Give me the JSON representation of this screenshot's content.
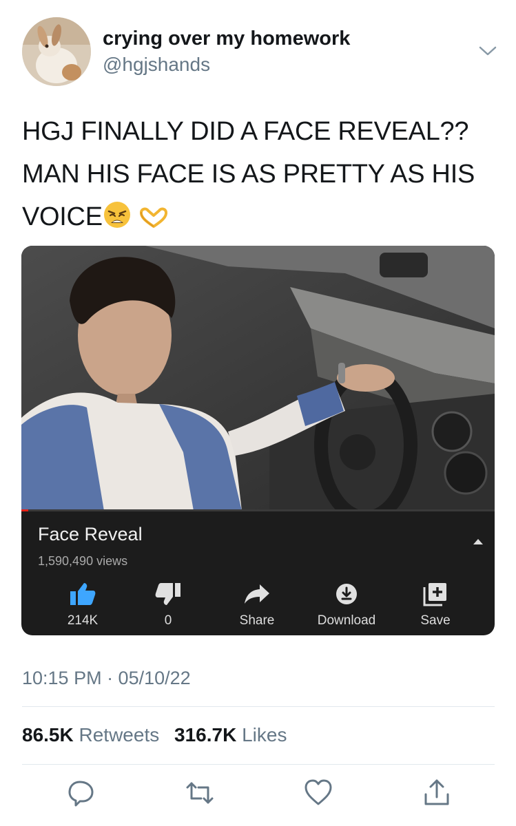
{
  "author": {
    "display_name": "crying over my homework",
    "handle": "@hgjshands"
  },
  "tweet": {
    "text_lines": [
      "HGJ FINALLY DID A FACE REVEAL??",
      "MAN HIS FACE IS AS PRETTY AS HIS",
      "VOICE"
    ],
    "emojis": [
      "weary-face-emoji",
      "heart-hands-emoji"
    ]
  },
  "video_card": {
    "title": "Face Reveal",
    "views": "1,590,490 views",
    "progress": 0.015,
    "actions": [
      {
        "icon": "thumbs-up-icon",
        "label": "214K"
      },
      {
        "icon": "thumbs-down-icon",
        "label": "0"
      },
      {
        "icon": "share-icon",
        "label": "Share"
      },
      {
        "icon": "download-icon",
        "label": "Download"
      },
      {
        "icon": "save-playlist-icon",
        "label": "Save"
      }
    ],
    "colors": {
      "like_accent": "#3ea6ff",
      "progress": "#e62117",
      "background": "#1c1c1c"
    }
  },
  "timestamp": "10:15 PM · 05/10/22",
  "stats": {
    "retweets_count": "86.5K",
    "retweets_label": "Retweets",
    "likes_count": "316.7K",
    "likes_label": "Likes"
  },
  "action_bar": [
    "reply-icon",
    "retweet-icon",
    "like-icon",
    "share-icon"
  ],
  "colors": {
    "text": "#14171a",
    "secondary": "#657786",
    "divider": "#e1e8ed",
    "icon": "#657786"
  }
}
